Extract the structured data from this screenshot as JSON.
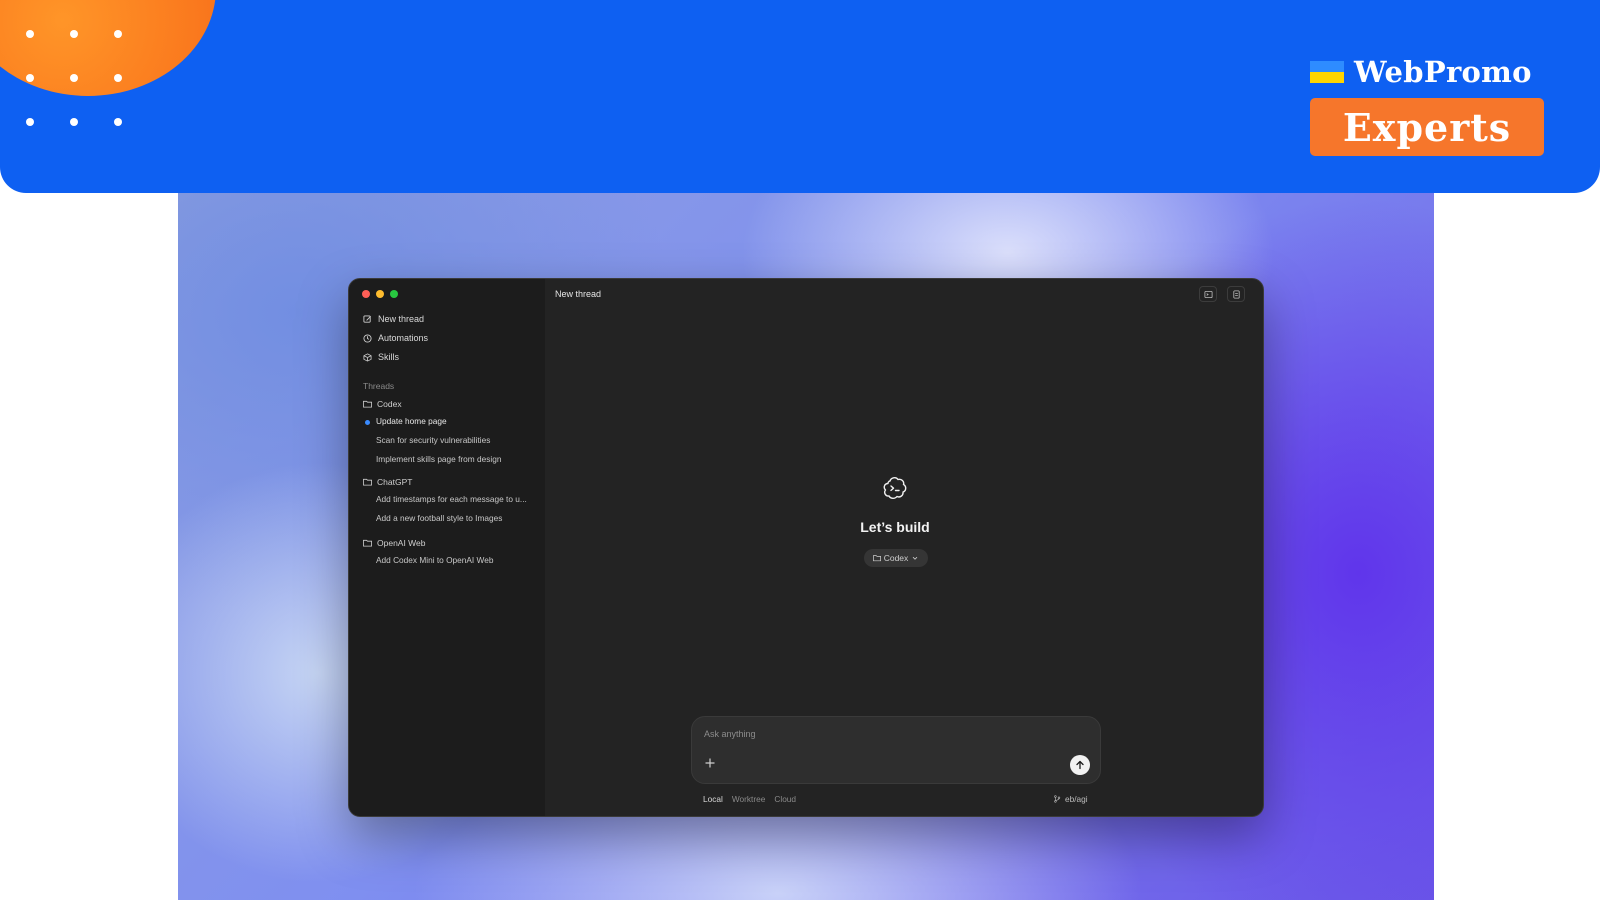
{
  "banner": {
    "brand_name": "WebPromo",
    "brand_sub": "Experts",
    "colors": {
      "background": "#0e60f2",
      "accent": "#f6762b",
      "flag_top": "#2e8cff",
      "flag_bottom": "#ffd500"
    }
  },
  "window": {
    "title": "New thread",
    "sidebar": {
      "nav": [
        {
          "label": "New thread",
          "icon": "edit-icon"
        },
        {
          "label": "Automations",
          "icon": "clock-icon"
        },
        {
          "label": "Skills",
          "icon": "cube-icon"
        }
      ],
      "section_label": "Threads",
      "projects": [
        {
          "name": "Codex",
          "threads": [
            "Update home page",
            "Scan for security vulnerabilities",
            "Implement skills page from design"
          ]
        },
        {
          "name": "ChatGPT",
          "threads": [
            "Add timestamps for each message to u...",
            "Add a new football style to Images"
          ]
        },
        {
          "name": "OpenAI Web",
          "threads": [
            "Add Codex Mini to OpenAI Web"
          ]
        }
      ],
      "active_thread": "Update home page"
    },
    "main": {
      "hero_icon": "terminal-cloud-icon",
      "hero_title": "Let’s build",
      "project_selector": "Codex",
      "composer_placeholder": "Ask anything",
      "modes": [
        "Local",
        "Worktree",
        "Cloud"
      ],
      "active_mode": "Local",
      "branch": "eb/agi"
    },
    "accent_color": "#3a8bff"
  }
}
